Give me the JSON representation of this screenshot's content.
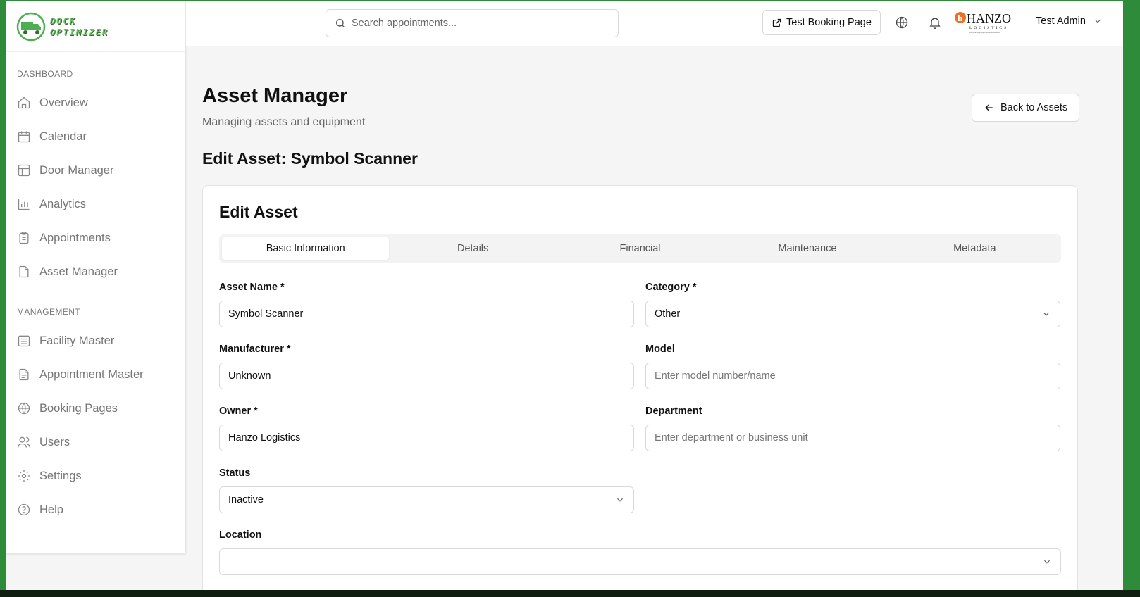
{
  "brand": {
    "logo_line1": "DOCK",
    "logo_line2": "OPTIMIZER"
  },
  "sidebar": {
    "section_dashboard": "DASHBOARD",
    "dashboard_items": [
      {
        "label": "Overview",
        "icon": "home-icon"
      },
      {
        "label": "Calendar",
        "icon": "calendar-icon"
      },
      {
        "label": "Door Manager",
        "icon": "layout-icon"
      },
      {
        "label": "Analytics",
        "icon": "bar-chart-icon"
      },
      {
        "label": "Appointments",
        "icon": "clipboard-icon"
      },
      {
        "label": "Asset Manager",
        "icon": "file-icon"
      }
    ],
    "section_management": "MANAGEMENT",
    "management_items": [
      {
        "label": "Facility Master",
        "icon": "building-icon"
      },
      {
        "label": "Appointment Master",
        "icon": "file-text-icon"
      },
      {
        "label": "Booking Pages",
        "icon": "globe-icon"
      },
      {
        "label": "Users",
        "icon": "users-icon"
      },
      {
        "label": "Settings",
        "icon": "gear-icon"
      },
      {
        "label": "Help",
        "icon": "help-circle-icon"
      }
    ]
  },
  "header": {
    "search_placeholder": "Search appointments...",
    "test_booking_label": "Test Booking Page",
    "user_name": "Test Admin",
    "partner_logo": {
      "main": "HANZO",
      "sub": "LOGISTICS",
      "tagline": "Global Supply Chain Solutions"
    }
  },
  "page": {
    "title": "Asset Manager",
    "subtitle": "Managing assets and equipment",
    "back_label": "Back to Assets",
    "edit_title": "Edit Asset: Symbol Scanner"
  },
  "card": {
    "title": "Edit Asset",
    "tabs": [
      "Basic Information",
      "Details",
      "Financial",
      "Maintenance",
      "Metadata"
    ],
    "active_tab": "Basic Information"
  },
  "form": {
    "asset_name": {
      "label": "Asset Name *",
      "value": "Symbol Scanner"
    },
    "category": {
      "label": "Category *",
      "value": "Other"
    },
    "manufacturer": {
      "label": "Manufacturer *",
      "value": "Unknown"
    },
    "model": {
      "label": "Model",
      "placeholder": "Enter model number/name"
    },
    "owner": {
      "label": "Owner *",
      "value": "Hanzo Logistics"
    },
    "department": {
      "label": "Department",
      "placeholder": "Enter department or business unit"
    },
    "status": {
      "label": "Status",
      "value": "Inactive"
    },
    "location": {
      "label": "Location",
      "value": ""
    }
  },
  "colors": {
    "brand_green": "#2e8b3a",
    "accent_orange": "#e8702a"
  }
}
